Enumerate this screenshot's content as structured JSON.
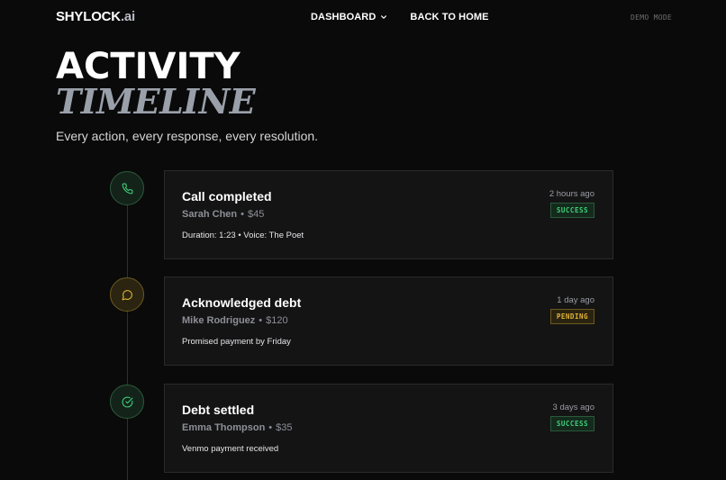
{
  "brand": {
    "name": "SHYLOCK",
    "suffix": ".ai"
  },
  "nav": {
    "dashboard_label": "DASHBOARD",
    "back_label": "BACK TO HOME"
  },
  "demo_mode": "DEMO MODE",
  "hero": {
    "title_line1": "ACTIVITY",
    "title_line2": "TIMELINE",
    "subtitle": "Every action, every response, every resolution."
  },
  "timeline": [
    {
      "icon": "phone-icon",
      "status_color": "#3fd07a",
      "title": "Call completed",
      "name": "Sarah Chen",
      "amount": "$45",
      "detail": "Duration: 1:23 • Voice: The Poet",
      "time": "2 hours ago",
      "badge": "SUCCESS"
    },
    {
      "icon": "message-icon",
      "status_color": "#e2b437",
      "title": "Acknowledged debt",
      "name": "Mike Rodriguez",
      "amount": "$120",
      "detail": "Promised payment by Friday",
      "time": "1 day ago",
      "badge": "PENDING"
    },
    {
      "icon": "check-circle-icon",
      "status_color": "#3fd07a",
      "title": "Debt settled",
      "name": "Emma Thompson",
      "amount": "$35",
      "detail": "Venmo payment received",
      "time": "3 days ago",
      "badge": "SUCCESS"
    }
  ]
}
